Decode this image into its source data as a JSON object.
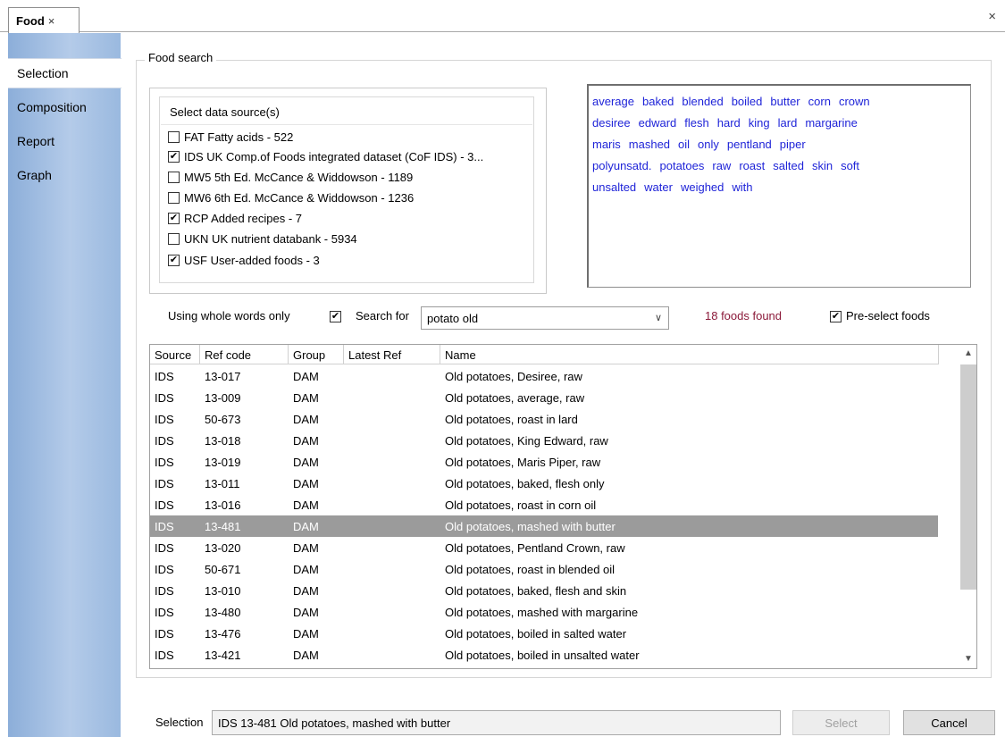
{
  "tab": {
    "label": "Food",
    "close_glyph": "×"
  },
  "window_close_glyph": "×",
  "sidebar": {
    "items": [
      {
        "label": "Selection",
        "active": true
      },
      {
        "label": "Composition",
        "active": false
      },
      {
        "label": "Report",
        "active": false
      },
      {
        "label": "Graph",
        "active": false
      }
    ]
  },
  "food_search": {
    "group_label": "Food search",
    "data_source": {
      "title": "Select data source(s)",
      "sources": [
        {
          "code": "FAT",
          "label": "FAT  Fatty acids - 522",
          "checked": false
        },
        {
          "code": "IDS",
          "label": "IDS  UK Comp.of Foods integrated dataset (CoF IDS) - 3...",
          "checked": true
        },
        {
          "code": "MW5",
          "label": "MW5  5th Ed. McCance & Widdowson - 1189",
          "checked": false
        },
        {
          "code": "MW6",
          "label": "MW6  6th Ed. McCance & Widdowson - 1236",
          "checked": false
        },
        {
          "code": "RCP",
          "label": "RCP  Added recipes - 7",
          "checked": true
        },
        {
          "code": "UKN",
          "label": "UKN  UK nutrient databank - 5934",
          "checked": false
        },
        {
          "code": "USF",
          "label": "USF  User-added foods - 3",
          "checked": true
        }
      ]
    },
    "keywords": [
      [
        "average",
        "baked",
        "blended",
        "boiled",
        "butter",
        "corn",
        "crown"
      ],
      [
        "desiree",
        "edward",
        "flesh",
        "hard",
        "king",
        "lard",
        "margarine"
      ],
      [
        "maris",
        "mashed",
        "oil",
        "only",
        "pentland",
        "piper"
      ],
      [
        "polyunsatd.",
        "potatoes",
        "raw",
        "roast",
        "salted",
        "skin",
        "soft"
      ],
      [
        "unsalted",
        "water",
        "weighed",
        "with"
      ]
    ],
    "whole_words_label": "Using whole words only",
    "whole_words_checked": true,
    "search_for_label": "Search for",
    "search_value": "potato old",
    "foods_found": "18 foods found",
    "foods_found_color": "#8b1a3a",
    "preselect_label": "Pre-select foods",
    "preselect_checked": true
  },
  "table": {
    "columns": [
      "Source",
      "Ref code",
      "Group",
      "Latest Ref",
      "Name"
    ],
    "selected_index": 7,
    "rows": [
      [
        "IDS",
        "13-017",
        "DAM",
        "",
        "Old potatoes, Desiree, raw"
      ],
      [
        "IDS",
        "13-009",
        "DAM",
        "",
        "Old potatoes, average, raw"
      ],
      [
        "IDS",
        "50-673",
        "DAM",
        "",
        "Old potatoes, roast in lard"
      ],
      [
        "IDS",
        "13-018",
        "DAM",
        "",
        "Old potatoes, King Edward, raw"
      ],
      [
        "IDS",
        "13-019",
        "DAM",
        "",
        "Old potatoes, Maris Piper, raw"
      ],
      [
        "IDS",
        "13-011",
        "DAM",
        "",
        "Old potatoes, baked, flesh only"
      ],
      [
        "IDS",
        "13-016",
        "DAM",
        "",
        "Old potatoes, roast in corn oil"
      ],
      [
        "IDS",
        "13-481",
        "DAM",
        "",
        "Old potatoes, mashed with butter"
      ],
      [
        "IDS",
        "13-020",
        "DAM",
        "",
        "Old potatoes, Pentland Crown, raw"
      ],
      [
        "IDS",
        "50-671",
        "DAM",
        "",
        "Old potatoes, roast in blended oil"
      ],
      [
        "IDS",
        "13-010",
        "DAM",
        "",
        "Old potatoes, baked, flesh and skin"
      ],
      [
        "IDS",
        "13-480",
        "DAM",
        "",
        "Old potatoes, mashed with margarine"
      ],
      [
        "IDS",
        "13-476",
        "DAM",
        "",
        "Old potatoes, boiled in salted water"
      ],
      [
        "IDS",
        "13-421",
        "DAM",
        "",
        "Old potatoes, boiled in unsalted water"
      ]
    ]
  },
  "footer": {
    "selection_label": "Selection",
    "selection_value": "IDS  13-481  Old potatoes, mashed with butter",
    "select_label": "Select",
    "cancel_label": "Cancel"
  },
  "colors": {
    "keyword_link": "#1f24d8",
    "selected_row": "#9b9b9b",
    "sidebar": "#a9c2e4"
  }
}
